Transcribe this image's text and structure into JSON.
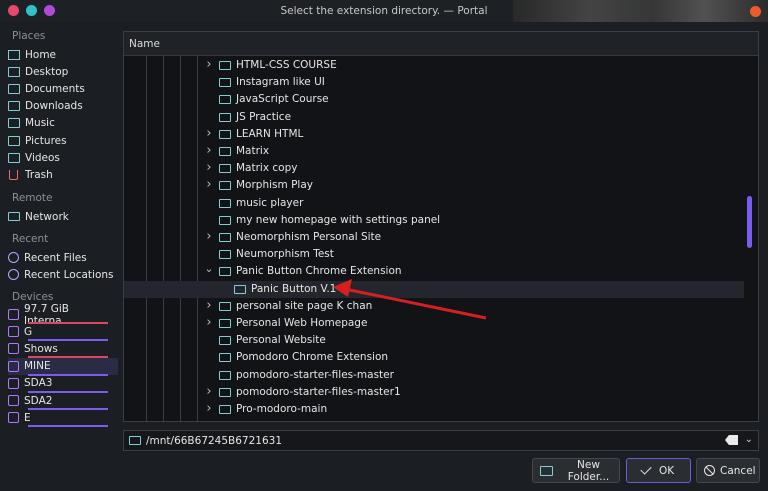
{
  "window": {
    "title": "Select the extension directory. — Portal",
    "buttons": {
      "close": "#f05a2a"
    }
  },
  "sidebar": {
    "places_label": "Places",
    "places": [
      {
        "label": "Home",
        "icon": "home-icon"
      },
      {
        "label": "Desktop",
        "icon": "folder-icon"
      },
      {
        "label": "Documents",
        "icon": "folder-icon"
      },
      {
        "label": "Downloads",
        "icon": "folder-icon"
      },
      {
        "label": "Music",
        "icon": "folder-icon"
      },
      {
        "label": "Pictures",
        "icon": "folder-icon"
      },
      {
        "label": "Videos",
        "icon": "folder-icon"
      },
      {
        "label": "Trash",
        "icon": "trash-icon"
      }
    ],
    "remote_label": "Remote",
    "remote": [
      {
        "label": "Network",
        "icon": "network-icon"
      }
    ],
    "recent_label": "Recent",
    "recent": [
      {
        "label": "Recent Files",
        "icon": "clock-icon"
      },
      {
        "label": "Recent Locations",
        "icon": "clock-icon"
      }
    ],
    "devices_label": "Devices",
    "devices": [
      {
        "label": "97.7 GiB Interna...",
        "icon": "drive-icon",
        "usage_color": "#d9485f"
      },
      {
        "label": "G",
        "icon": "drive-icon",
        "usage_color": "#7a5cf0"
      },
      {
        "label": "Shows",
        "icon": "drive-icon",
        "usage_color": "#d9485f"
      },
      {
        "label": "MINE",
        "icon": "drive-icon",
        "selected": true,
        "usage_color": "#7a5cf0"
      },
      {
        "label": "SDA3",
        "icon": "drive-icon",
        "usage_color": "#7a5cf0"
      },
      {
        "label": "SDA2",
        "icon": "drive-icon",
        "usage_color": "#7a5cf0"
      },
      {
        "label": "E",
        "icon": "drive-icon",
        "usage_color": "#7a5cf0"
      }
    ]
  },
  "tree": {
    "column_header": "Name",
    "rows": [
      {
        "name": "HTML-CSS COURSE",
        "expandable": true
      },
      {
        "name": "Instagram like UI",
        "expandable": false
      },
      {
        "name": "JavaScript Course",
        "expandable": false
      },
      {
        "name": "JS Practice",
        "expandable": false
      },
      {
        "name": "LEARN HTML",
        "expandable": true
      },
      {
        "name": "Matrix",
        "expandable": true
      },
      {
        "name": "Matrix copy",
        "expandable": true
      },
      {
        "name": "Morphism Play",
        "expandable": true
      },
      {
        "name": "music player",
        "expandable": false
      },
      {
        "name": "my new homepage with settings panel",
        "expandable": false
      },
      {
        "name": "Neomorphism Personal Site",
        "expandable": true
      },
      {
        "name": "Neumorphism Test",
        "expandable": false
      },
      {
        "name": "Panic Button Chrome Extension",
        "expandable": true,
        "expanded": true
      },
      {
        "name": "Panic Button V.1",
        "expandable": false,
        "child": true,
        "selected": true
      },
      {
        "name": "personal site page K chan",
        "expandable": true
      },
      {
        "name": "Personal Web Homepage",
        "expandable": true
      },
      {
        "name": "Personal Website",
        "expandable": false
      },
      {
        "name": "Pomodoro Chrome Extension",
        "expandable": false
      },
      {
        "name": "pomodoro-starter-files-master",
        "expandable": false
      },
      {
        "name": "pomodoro-starter-files-master1",
        "expandable": true
      },
      {
        "name": "Pro-modoro-main",
        "expandable": true
      }
    ]
  },
  "path": {
    "value": "/mnt/66B67245B6721631"
  },
  "actions": {
    "new_folder": "New Folder...",
    "ok": "OK",
    "cancel": "Cancel"
  },
  "colors": {
    "accent": "#7a5cf0",
    "folder": "#7fd0d4",
    "annotation_arrow": "#d62020"
  }
}
